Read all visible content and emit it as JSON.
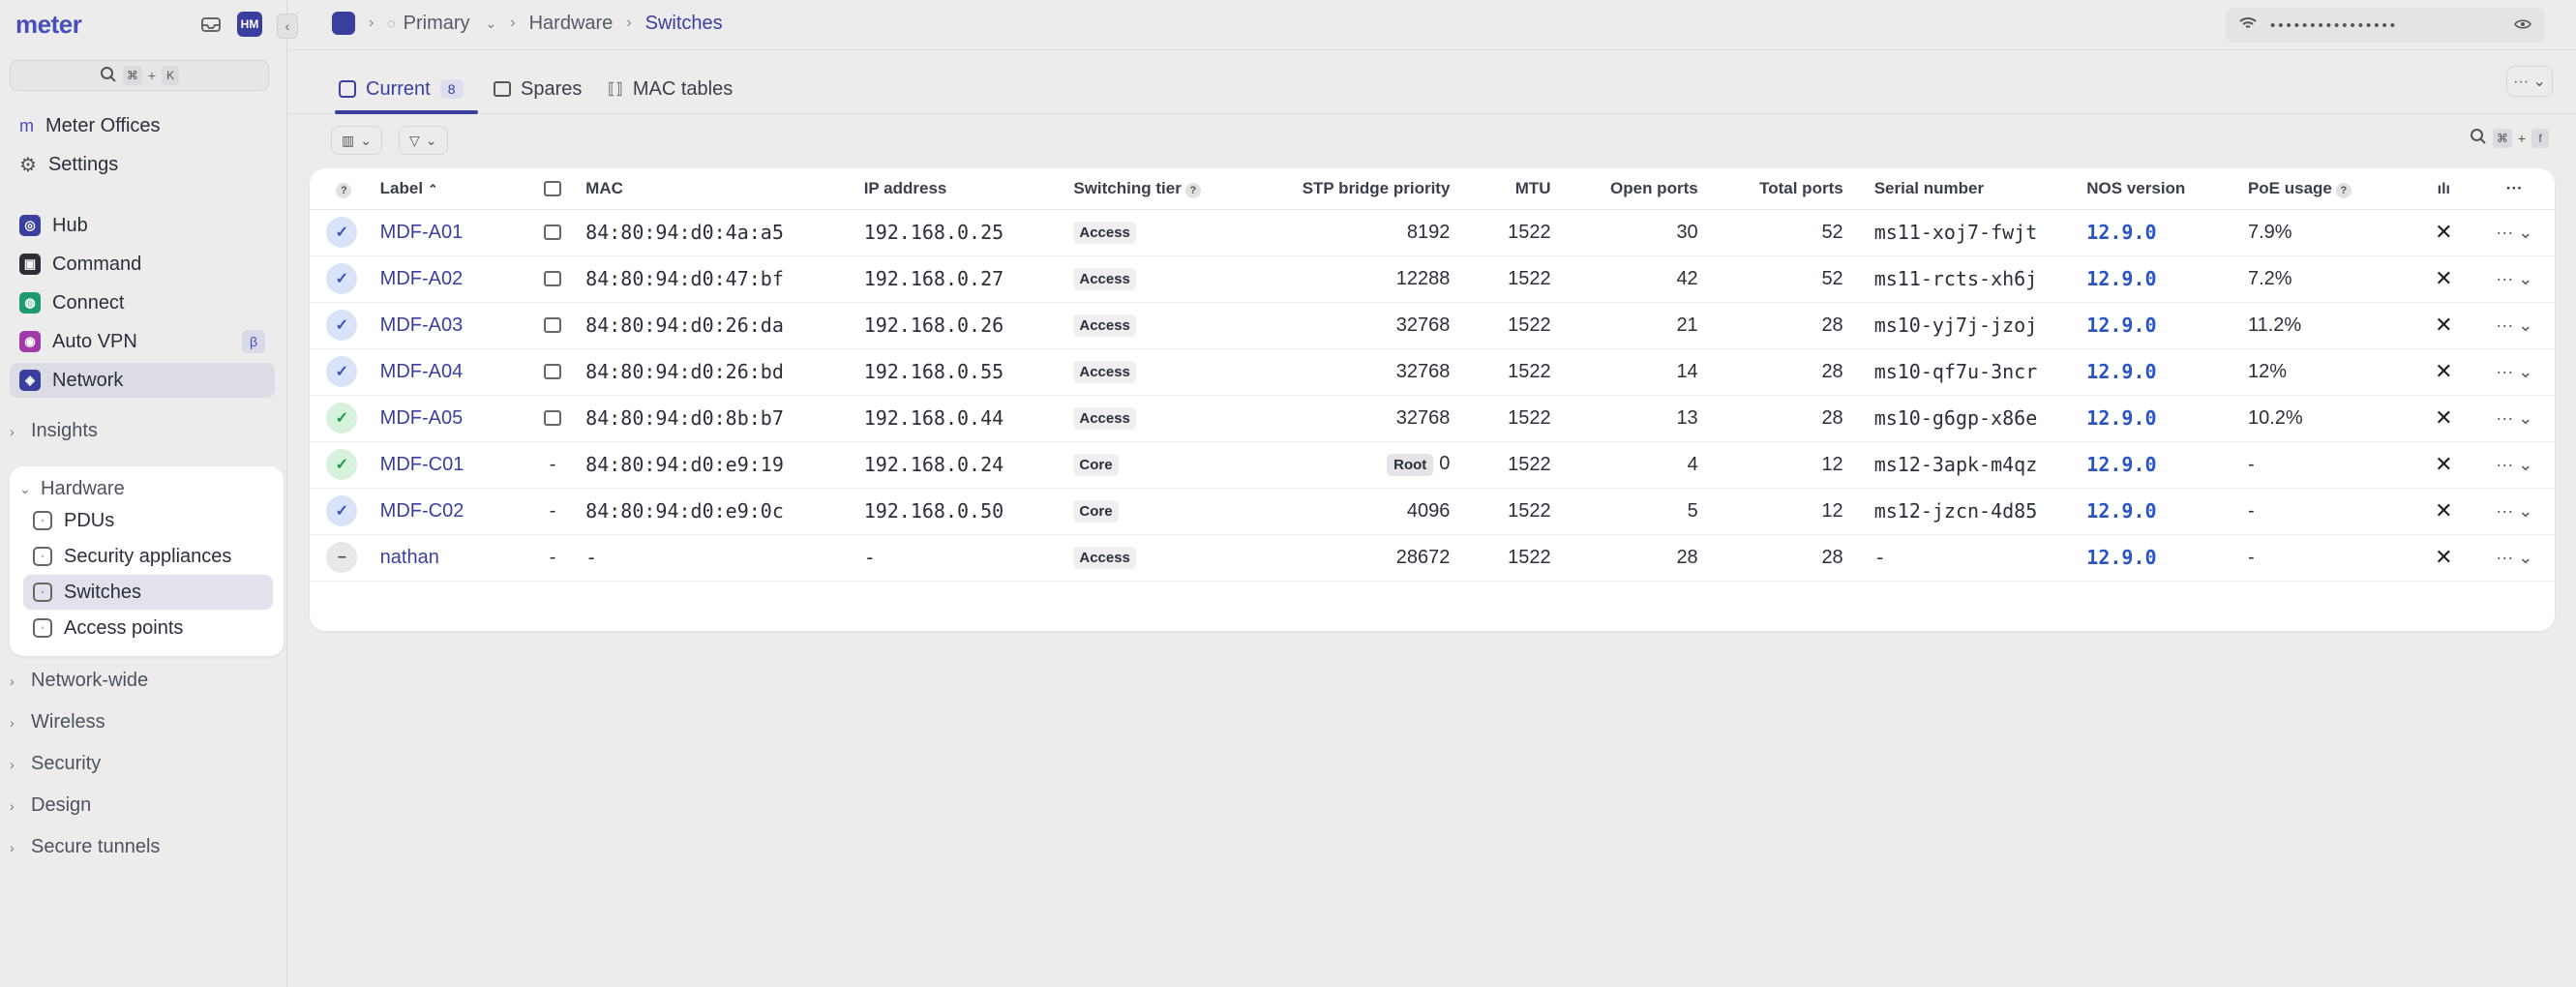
{
  "sidebar": {
    "logo": "meter",
    "avatar_initials": "HM",
    "search_shortcut_keys": [
      "⌘",
      "+",
      "K"
    ],
    "org_items": [
      {
        "label": "Meter Offices",
        "icon": "building-icon"
      },
      {
        "label": "Settings",
        "icon": "gear-icon"
      }
    ],
    "apps": [
      {
        "label": "Hub",
        "color": "#3a3f9e"
      },
      {
        "label": "Command",
        "color": "#2e2e38"
      },
      {
        "label": "Connect",
        "color": "#1f9a6e"
      },
      {
        "label": "Auto VPN",
        "color": "#a03aa8",
        "badge": "β"
      },
      {
        "label": "Network",
        "color": "#3a3f9e"
      }
    ],
    "sections_before": [
      "Insights"
    ],
    "hardware": {
      "title": "Hardware",
      "items": [
        "PDUs",
        "Security appliances",
        "Switches",
        "Access points"
      ]
    },
    "sections_after": [
      "Network-wide",
      "Wireless",
      "Security",
      "Design",
      "Secure tunnels"
    ]
  },
  "header": {
    "breadcrumbs": [
      "Primary",
      "Hardware",
      "Switches"
    ],
    "wifi_password_masked": "••••••••••••••••"
  },
  "tabs": [
    {
      "label": "Current",
      "count": "8"
    },
    {
      "label": "Spares"
    },
    {
      "label": "MAC tables"
    }
  ],
  "search_shortcut_keys": [
    "⌘",
    "+",
    "f"
  ],
  "table": {
    "headers": {
      "label": "Label",
      "mac": "MAC",
      "ip": "IP address",
      "tier": "Switching tier",
      "stp": "STP bridge priority",
      "mtu": "MTU",
      "open_ports": "Open ports",
      "total_ports": "Total ports",
      "serial": "Serial number",
      "nos": "NOS version",
      "poe": "PoE usage"
    },
    "rows": [
      {
        "status": "blue",
        "label": "MDF-A01",
        "dev": true,
        "mac": "84:80:94:d0:4a:a5",
        "ip": "192.168.0.25",
        "tier": "Access",
        "stp": "8192",
        "root": "",
        "mtu": "1522",
        "open": "30",
        "total": "52",
        "serial": "ms11-xoj7-fwjt",
        "nos": "12.9.0",
        "poe": "7.9%"
      },
      {
        "status": "blue",
        "label": "MDF-A02",
        "dev": true,
        "mac": "84:80:94:d0:47:bf",
        "ip": "192.168.0.27",
        "tier": "Access",
        "stp": "12288",
        "root": "",
        "mtu": "1522",
        "open": "42",
        "total": "52",
        "serial": "ms11-rcts-xh6j",
        "nos": "12.9.0",
        "poe": "7.2%"
      },
      {
        "status": "blue",
        "label": "MDF-A03",
        "dev": true,
        "mac": "84:80:94:d0:26:da",
        "ip": "192.168.0.26",
        "tier": "Access",
        "stp": "32768",
        "root": "",
        "mtu": "1522",
        "open": "21",
        "total": "28",
        "serial": "ms10-yj7j-jzoj",
        "nos": "12.9.0",
        "poe": "11.2%"
      },
      {
        "status": "blue",
        "label": "MDF-A04",
        "dev": true,
        "mac": "84:80:94:d0:26:bd",
        "ip": "192.168.0.55",
        "tier": "Access",
        "stp": "32768",
        "root": "",
        "mtu": "1522",
        "open": "14",
        "total": "28",
        "serial": "ms10-qf7u-3ncr",
        "nos": "12.9.0",
        "poe": "12%"
      },
      {
        "status": "green",
        "label": "MDF-A05",
        "dev": true,
        "mac": "84:80:94:d0:8b:b7",
        "ip": "192.168.0.44",
        "tier": "Access",
        "stp": "32768",
        "root": "",
        "mtu": "1522",
        "open": "13",
        "total": "28",
        "serial": "ms10-g6gp-x86e",
        "nos": "12.9.0",
        "poe": "10.2%"
      },
      {
        "status": "green",
        "label": "MDF-C01",
        "dev": false,
        "mac": "84:80:94:d0:e9:19",
        "ip": "192.168.0.24",
        "tier": "Core",
        "stp": "0",
        "root": "Root",
        "mtu": "1522",
        "open": "4",
        "total": "12",
        "serial": "ms12-3apk-m4qz",
        "nos": "12.9.0",
        "poe": "-"
      },
      {
        "status": "blue",
        "label": "MDF-C02",
        "dev": false,
        "mac": "84:80:94:d0:e9:0c",
        "ip": "192.168.0.50",
        "tier": "Core",
        "stp": "4096",
        "root": "",
        "mtu": "1522",
        "open": "5",
        "total": "12",
        "serial": "ms12-jzcn-4d85",
        "nos": "12.9.0",
        "poe": "-"
      },
      {
        "status": "gray",
        "label": "nathan",
        "dev": false,
        "mac": "-",
        "ip": "-",
        "tier": "Access",
        "stp": "28672",
        "root": "",
        "mtu": "1522",
        "open": "28",
        "total": "28",
        "serial": "-",
        "nos": "12.9.0",
        "poe": "-"
      }
    ]
  }
}
